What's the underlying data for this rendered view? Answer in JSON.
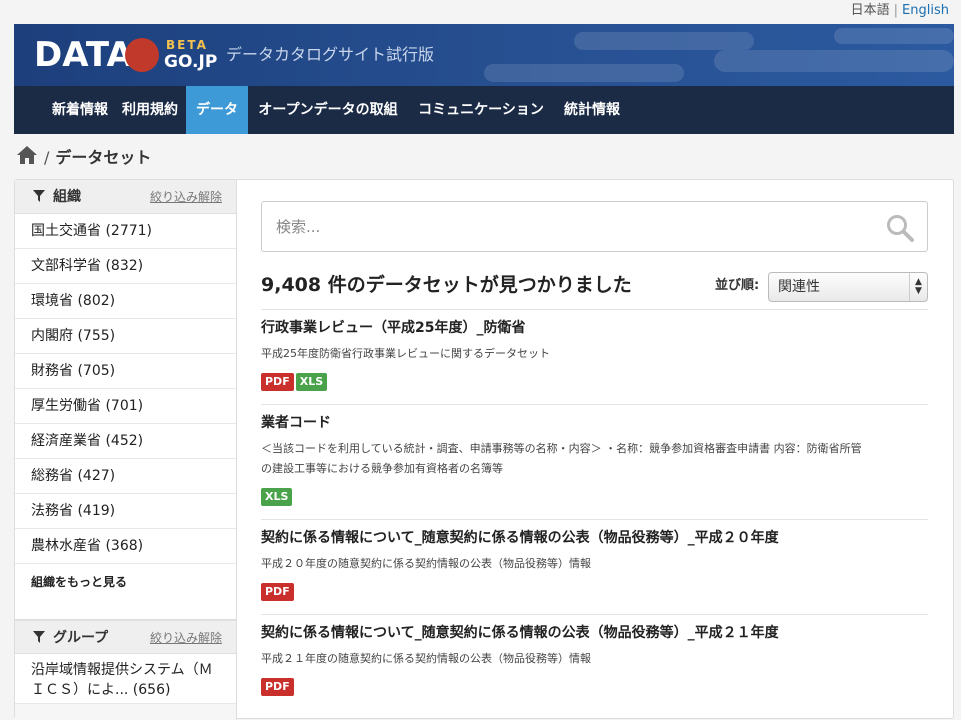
{
  "language": {
    "japanese": "日本語",
    "separator": "|",
    "english": "English"
  },
  "logo": {
    "data_text": "DATA",
    "beta": "BETA",
    "gojp": "GO.JP"
  },
  "site_tagline": "データカタログサイト試行版",
  "nav": [
    {
      "label": "新着情報",
      "active": false
    },
    {
      "label": "利用規約",
      "active": false
    },
    {
      "label": "データ",
      "active": true
    },
    {
      "label": "オープンデータの取組",
      "active": false
    },
    {
      "label": "コミュニケーション",
      "active": false
    },
    {
      "label": "統計情報",
      "active": false
    }
  ],
  "breadcrumb": {
    "separator": "/",
    "current": "データセット"
  },
  "facets": {
    "organization": {
      "title": "組織",
      "clear_label": "絞り込み解除",
      "items": [
        "国土交通省 (2771)",
        "文部科学省 (832)",
        "環境省 (802)",
        "内閣府 (755)",
        "財務省 (705)",
        "厚生労働省 (701)",
        "経済産業省 (452)",
        "総務省 (427)",
        "法務省 (419)",
        "農林水産省 (368)"
      ],
      "more_label": "組織をもっと見る"
    },
    "group": {
      "title": "グループ",
      "clear_label": "絞り込み解除",
      "items": [
        {
          "line1": "沿岸域情報提供システム（Ｍ",
          "line2": "ＩＣＳ）によ... (656)"
        }
      ]
    }
  },
  "search": {
    "placeholder": "検索...",
    "value": ""
  },
  "results": {
    "count_text": "9,408 件のデータセットが見つかりました",
    "sort_label": "並び順:",
    "sort_value": "関連性",
    "items": [
      {
        "title": "行政事業レビュー（平成25年度）_防衛省",
        "description": "平成25年度防衛省行政事業レビューに関するデータセット",
        "description_2": "",
        "formats": [
          "PDF",
          "XLS"
        ]
      },
      {
        "title": "業者コード",
        "description": "＜当該コードを利用している統計・調査、申請事務等の名称・内容＞ ・名称：競争参加資格審査申請書 内容：防衛省所管",
        "description_2": "の建設工事等における競争参加有資格者の名簿等",
        "formats": [
          "XLS"
        ]
      },
      {
        "title": "契約に係る情報について_随意契約に係る情報の公表（物品役務等）_平成２０年度",
        "description": "平成２０年度の随意契約に係る契約情報の公表（物品役務等）情報",
        "description_2": "",
        "formats": [
          "PDF"
        ]
      },
      {
        "title": "契約に係る情報について_随意契約に係る情報の公表（物品役務等）_平成２１年度",
        "description": "平成２１年度の随意契約に係る契約情報の公表（物品役務等）情報",
        "description_2": "",
        "formats": [
          "PDF"
        ]
      }
    ]
  },
  "colors": {
    "nav_active": "#3d9ad6",
    "navbar": "#1b2a45",
    "pdf": "#c9302c",
    "xls": "#4aa34a",
    "masthead": "#264f90"
  }
}
